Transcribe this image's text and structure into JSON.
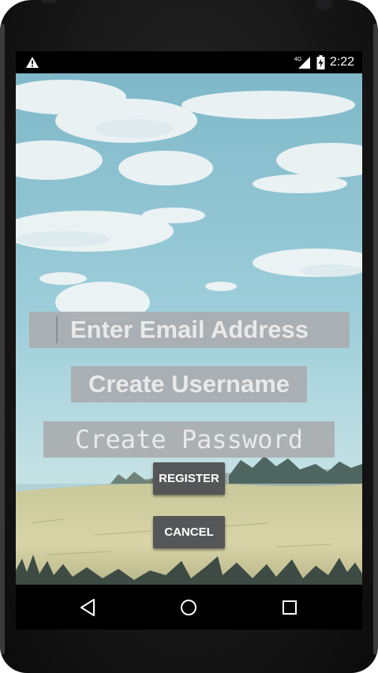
{
  "status_bar": {
    "alert_icon": "warning-triangle-icon",
    "network_label": "4G",
    "signal_icon": "cell-signal-icon",
    "battery_icon": "battery-charging-icon",
    "time": "2:22"
  },
  "form": {
    "email_placeholder": "Enter Email Address",
    "username_placeholder": "Create Username",
    "password_placeholder": "Create Password",
    "register_label": "REGISTER",
    "cancel_label": "CANCEL"
  },
  "nav_bar": {
    "back_icon": "back-triangle-icon",
    "home_icon": "home-circle-icon",
    "recents_icon": "recents-square-icon"
  },
  "colors": {
    "field_background": "#aaacaf",
    "field_text": "#e9e9ea",
    "button_background": "#555657",
    "sky": "#8fc4d3"
  }
}
